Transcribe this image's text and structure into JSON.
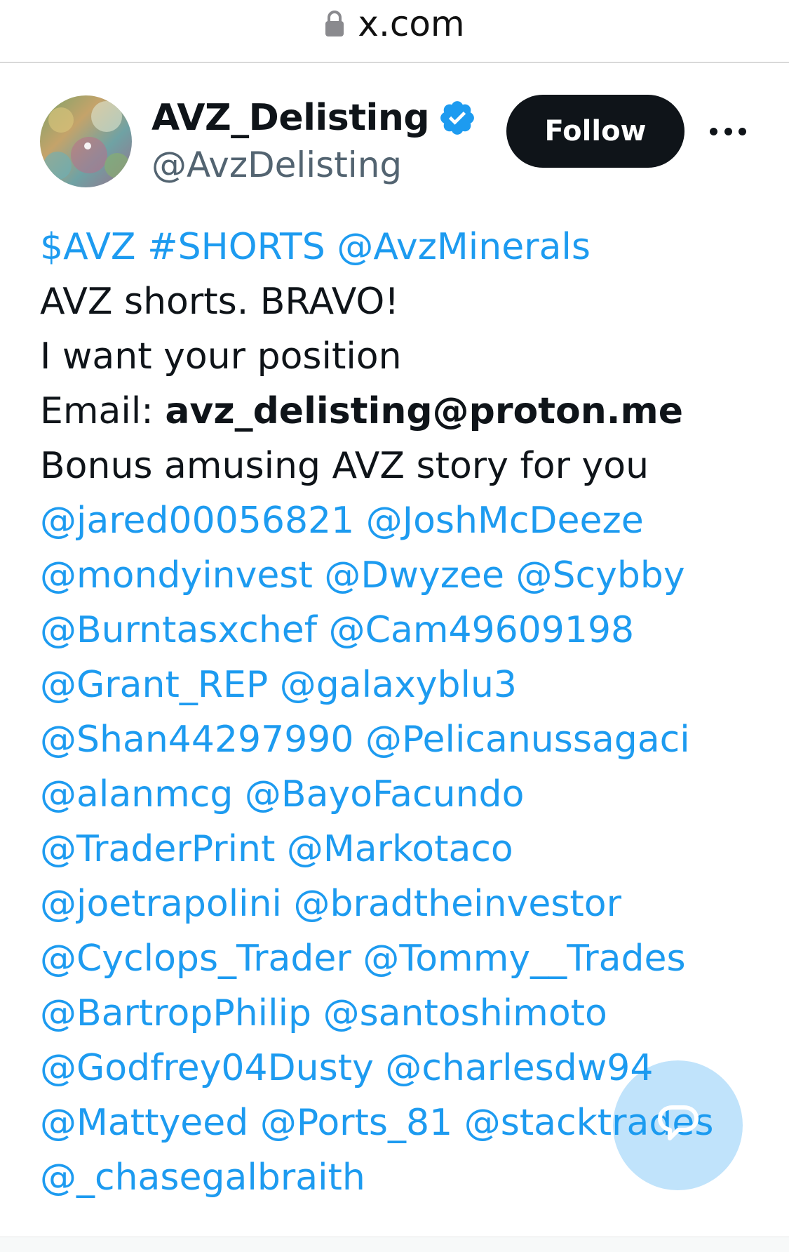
{
  "browser": {
    "url": "x.com",
    "lock_icon": "lock-icon"
  },
  "tweet": {
    "author": {
      "display_name": "AVZ_Delisting",
      "handle": "@AvzDelisting",
      "verified": true,
      "verified_icon": "verified-badge-icon"
    },
    "follow_label": "Follow",
    "more_icon": "more-horizontal-icon",
    "tags": {
      "cashtag": "$AVZ",
      "hashtag": "#SHORTS",
      "mention": "@AvzMinerals"
    },
    "line1": "AVZ shorts. BRAVO!",
    "line2": "I want your position",
    "email_label": "Email: ",
    "email": "avz_delisting@proton.me",
    "line4": "Bonus amusing AVZ story for you",
    "mention_lines": [
      [
        "@jared00056821",
        "@JoshMcDeeze"
      ],
      [
        "@mondyinvest",
        "@Dwyzee",
        "@Scybby"
      ],
      [
        "@Burntasxchef",
        "@Cam49609198"
      ],
      [
        "@Grant_REP",
        "@galaxyblu3"
      ],
      [
        "@Shan44297990",
        "@Pelicanussagaci"
      ],
      [
        "@alanmcg",
        "@BayoFacundo"
      ],
      [
        "@TraderPrint",
        "@Markotaco"
      ],
      [
        "@joetrapolini",
        "@bradtheinvestor"
      ],
      [
        "@Cyclops_Trader",
        "@Tommy__Trades"
      ],
      [
        "@BartropPhilip",
        "@santoshimoto"
      ],
      [
        "@Godfrey04Dusty",
        "@charlesdw94"
      ],
      [
        "@Mattyeed",
        "@Ports_81",
        "@stacktrades"
      ],
      [
        "@_chasegalbraith"
      ]
    ]
  },
  "fab": {
    "icon": "compose-icon"
  },
  "colors": {
    "link": "#1d9bf0",
    "text": "#0f1419",
    "muted": "#536471",
    "follow_bg": "#0f1419"
  }
}
